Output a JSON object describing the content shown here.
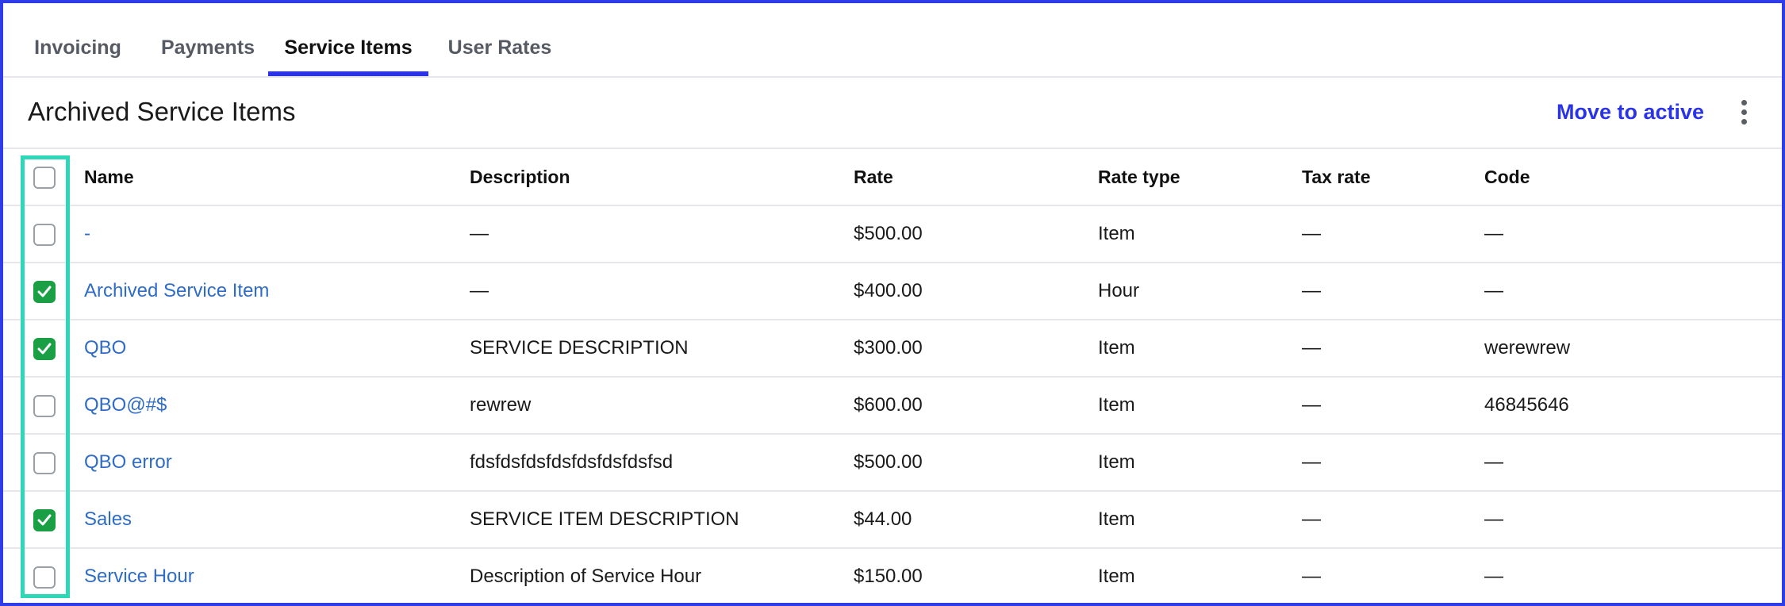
{
  "tabs": [
    {
      "label": "Invoicing",
      "active": false
    },
    {
      "label": "Payments",
      "active": false
    },
    {
      "label": "Service Items",
      "active": true
    },
    {
      "label": "User Rates",
      "active": false
    }
  ],
  "header": {
    "title": "Archived Service Items",
    "move_label": "Move to active"
  },
  "table": {
    "columns": {
      "name": "Name",
      "description": "Description",
      "rate": "Rate",
      "rate_type": "Rate type",
      "tax_rate": "Tax rate",
      "code": "Code"
    },
    "rows": [
      {
        "checked": false,
        "name": "-",
        "description": "—",
        "rate": "$500.00",
        "rate_type": "Item",
        "tax_rate": "—",
        "code": "—"
      },
      {
        "checked": true,
        "name": "Archived Service Item",
        "description": "—",
        "rate": "$400.00",
        "rate_type": "Hour",
        "tax_rate": "—",
        "code": "—"
      },
      {
        "checked": true,
        "name": "QBO",
        "description": "SERVICE DESCRIPTION",
        "rate": "$300.00",
        "rate_type": "Item",
        "tax_rate": "—",
        "code": "werewrew"
      },
      {
        "checked": false,
        "name": "QBO@#$",
        "description": "rewrew",
        "rate": "$600.00",
        "rate_type": "Item",
        "tax_rate": "—",
        "code": "46845646"
      },
      {
        "checked": false,
        "name": "QBO error",
        "description": "fdsfdsfdsfdsfdsfdsfdsfsd",
        "rate": "$500.00",
        "rate_type": "Item",
        "tax_rate": "—",
        "code": "—"
      },
      {
        "checked": true,
        "name": "Sales",
        "description": "SERVICE ITEM DESCRIPTION",
        "rate": "$44.00",
        "rate_type": "Item",
        "tax_rate": "—",
        "code": "—"
      },
      {
        "checked": false,
        "name": "Service Hour",
        "description": "Description of Service Hour",
        "rate": "$150.00",
        "rate_type": "Item",
        "tax_rate": "—",
        "code": "—"
      }
    ]
  },
  "colors": {
    "accent": "#2a34e6",
    "link": "#2f6cc5",
    "checked": "#1a9f45",
    "highlight": "#2fd7b9"
  },
  "icons": {
    "checkbox_checked": "checkmark-icon",
    "more": "more-vertical-icon"
  }
}
